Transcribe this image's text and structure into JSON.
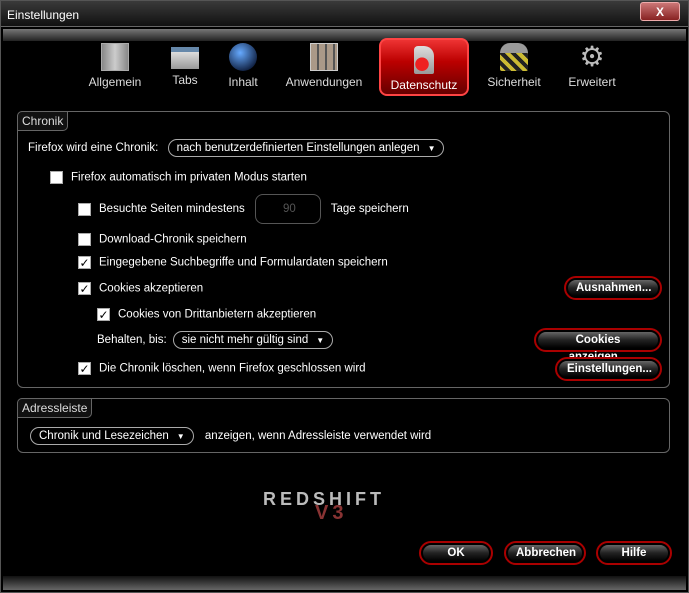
{
  "window": {
    "title": "Einstellungen",
    "close": "X"
  },
  "tabs": [
    {
      "label": "Allgemein",
      "icon": "sliders-icon"
    },
    {
      "label": "Tabs",
      "icon": "tabs-icon"
    },
    {
      "label": "Inhalt",
      "icon": "globe-icon"
    },
    {
      "label": "Anwendungen",
      "icon": "applications-icon"
    },
    {
      "label": "Datenschutz",
      "icon": "privacy-lock-icon",
      "active": true
    },
    {
      "label": "Sicherheit",
      "icon": "padlock-icon"
    },
    {
      "label": "Erweitert",
      "icon": "gear-icon"
    }
  ],
  "chronik": {
    "legend": "Chronik",
    "mode_label": "Firefox wird eine Chronik:",
    "mode_value": "nach benutzerdefinierten Einstellungen anlegen",
    "private_mode": {
      "label": "Firefox automatisch im privaten Modus starten",
      "checked": false
    },
    "visited": {
      "label": "Besuchte Seiten mindestens",
      "checked": false,
      "days": "90",
      "suffix": "Tage speichern"
    },
    "downloads": {
      "label": "Download-Chronik speichern",
      "checked": false
    },
    "forms": {
      "label": "Eingegebene Suchbegriffe und Formulardaten speichern",
      "checked": true
    },
    "cookies": {
      "label": "Cookies akzeptieren",
      "checked": true
    },
    "third_party": {
      "label": "Cookies von Drittanbietern akzeptieren",
      "checked": true
    },
    "keep_label": "Behalten, bis:",
    "keep_value": "sie nicht mehr gültig sind",
    "clear": {
      "label": "Die Chronik löschen, wenn Firefox geschlossen wird",
      "checked": true
    },
    "exceptions_button": "Ausnahmen...",
    "show_cookies_button": "Cookies anzeigen...",
    "settings_button": "Einstellungen..."
  },
  "adressleiste": {
    "legend": "Adressleiste",
    "value": "Chronik und Lesezeichen",
    "suffix": "anzeigen, wenn Adressleiste verwendet wird"
  },
  "logo": {
    "text": "REDSHIFT",
    "version": "V3"
  },
  "footer": {
    "ok": "OK",
    "cancel": "Abbrechen",
    "help": "Hilfe"
  }
}
